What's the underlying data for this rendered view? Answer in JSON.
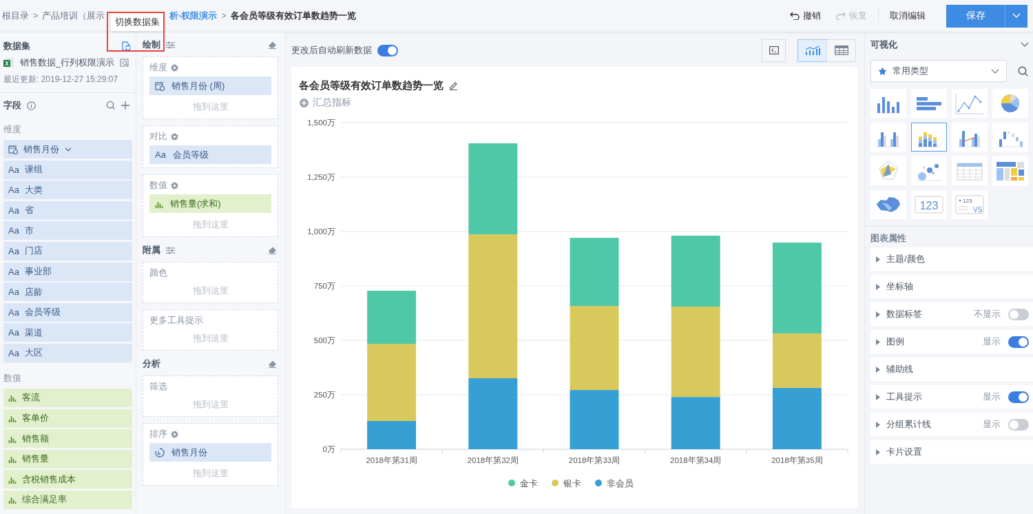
{
  "breadcrumb": [
    {
      "kind": "crumb",
      "label": "根目录"
    },
    {
      "kind": "separator",
      "label": ">"
    },
    {
      "kind": "crumb",
      "label": "产品培训（展示"
    },
    {
      "kind": "link",
      "label": "析-权限演示"
    },
    {
      "kind": "separator",
      "label": ">"
    },
    {
      "kind": "current",
      "label": "各会员等级有效订单数趋势一览"
    }
  ],
  "tooltip": {
    "text": "切换数据集"
  },
  "toolbar": {
    "undo": {
      "label": "撤销",
      "disabled": false
    },
    "redo": {
      "label": "恢复",
      "disabled": true
    },
    "cancel": "取消编辑",
    "save": "保存"
  },
  "dataset": {
    "title": "数据集",
    "name": "销售数据_行列权限演示",
    "updated": "最近更新: 2019-12-27 15:29:07"
  },
  "fields": {
    "title": "字段",
    "groups": [
      {
        "title": "维度",
        "kind": "dimension",
        "items": [
          {
            "label": "销售月份",
            "kind": "date",
            "expandable": true
          },
          {
            "label": "课组",
            "kind": "text",
            "type_label": "Aa"
          },
          {
            "label": "大类",
            "kind": "text",
            "type_label": "Aa"
          },
          {
            "label": "省",
            "kind": "text",
            "type_label": "Aa"
          },
          {
            "label": "市",
            "kind": "text",
            "type_label": "Aa"
          },
          {
            "label": "门店",
            "kind": "text",
            "type_label": "Aa"
          },
          {
            "label": "事业部",
            "kind": "text",
            "type_label": "Aa"
          },
          {
            "label": "店龄",
            "kind": "text",
            "type_label": "Aa"
          },
          {
            "label": "会员等级",
            "kind": "text",
            "type_label": "Aa"
          },
          {
            "label": "渠道",
            "kind": "text",
            "type_label": "Aa"
          },
          {
            "label": "大区",
            "kind": "text",
            "type_label": "Aa"
          }
        ]
      },
      {
        "title": "数值",
        "kind": "measure",
        "items": [
          {
            "label": "客流",
            "kind": "measure"
          },
          {
            "label": "客单价",
            "kind": "measure"
          },
          {
            "label": "销售额",
            "kind": "measure"
          },
          {
            "label": "销售量",
            "kind": "measure"
          },
          {
            "label": "含税销售成本",
            "kind": "measure"
          },
          {
            "label": "综合满足率",
            "kind": "measure"
          }
        ]
      }
    ]
  },
  "shelves": [
    {
      "title": "绘制",
      "adjustable": true,
      "wells": [
        {
          "label": "维度",
          "gear": true,
          "chips": [
            {
              "label": "销售月份 (周)",
              "kind": "date"
            }
          ],
          "hint": "拖到这里"
        },
        {
          "label": "对比",
          "gear": true,
          "chips": [
            {
              "label": "会员等级",
              "kind": "text",
              "type_label": "Aa"
            }
          ]
        },
        {
          "label": "数值",
          "gear": true,
          "chips": [
            {
              "label": "销售量(求和)",
              "kind": "measure"
            }
          ],
          "hint": "拖到这里"
        }
      ]
    },
    {
      "title": "附属",
      "adjustable": true,
      "wells": [
        {
          "label": "颜色",
          "gear": false,
          "hint": "拖到这里"
        },
        {
          "label": "更多工具提示",
          "gear": false,
          "hint": "拖到这里"
        }
      ]
    },
    {
      "title": "分析",
      "adjustable": false,
      "wells": [
        {
          "label": "筛选",
          "gear": false,
          "hint": "拖到这里"
        },
        {
          "label": "排序",
          "gear": true,
          "chips": [
            {
              "label": "销售月份",
              "kind": "sort"
            }
          ],
          "hint": "拖到这里"
        }
      ]
    }
  ],
  "canvas": {
    "auto_refresh": {
      "label": "更改后自动刷新数据",
      "on": true
    },
    "views": [
      {
        "kind": "code",
        "selected": false
      },
      {
        "kind": "chart",
        "selected": true
      },
      {
        "kind": "table",
        "selected": false
      }
    ],
    "title": "各会员等级有效订单数趋势一览",
    "summary": "汇总指标",
    "chart_data": {
      "type": "bar",
      "stacked": true,
      "categories": [
        "2018年第31周",
        "2018年第32周",
        "2018年第33周",
        "2018年第34周",
        "2018年第35周"
      ],
      "series": [
        {
          "name": "金卡",
          "color": "#4fc8a8",
          "values": [
            244,
            418,
            313,
            326,
            417
          ]
        },
        {
          "name": "银卡",
          "color": "#d9c95c",
          "values": [
            354,
            661,
            386,
            415,
            250
          ]
        },
        {
          "name": "非会员",
          "color": "#36a0d4",
          "values": [
            130,
            326,
            272,
            240,
            282
          ]
        }
      ],
      "ylim": [
        0,
        1500
      ],
      "grid": true,
      "legend": true,
      "yticks": [
        {
          "value": 0,
          "label": "0万"
        },
        {
          "value": 250,
          "label": "250万"
        },
        {
          "value": 500,
          "label": "500万"
        },
        {
          "value": 750,
          "label": "750万"
        },
        {
          "value": 1000,
          "label": "1,000万"
        },
        {
          "value": 1250,
          "label": "1,250万"
        },
        {
          "value": 1500,
          "label": "1,500万"
        }
      ]
    }
  },
  "visual": {
    "title": "可视化",
    "category": "常用类型",
    "types": [
      {
        "kind": "bar",
        "selected": false
      },
      {
        "kind": "hbar",
        "selected": false
      },
      {
        "kind": "line",
        "selected": false
      },
      {
        "kind": "pie",
        "selected": false
      },
      {
        "kind": "grouped",
        "selected": false
      },
      {
        "kind": "stacked",
        "selected": true
      },
      {
        "kind": "combo",
        "selected": false
      },
      {
        "kind": "waterfall",
        "selected": false
      },
      {
        "kind": "radar",
        "selected": false
      },
      {
        "kind": "bubble",
        "selected": false
      },
      {
        "kind": "table",
        "selected": false
      },
      {
        "kind": "treemap",
        "selected": false
      },
      {
        "kind": "map",
        "selected": false
      },
      {
        "kind": "kpi",
        "selected": false,
        "text": "123"
      },
      {
        "kind": "compare",
        "selected": false,
        "text": "123",
        "text_2": "VS"
      }
    ]
  },
  "properties": {
    "title": "图表属性",
    "items": [
      {
        "label": "主题/颜色"
      },
      {
        "label": "坐标轴"
      },
      {
        "label": "数据标签",
        "toggle": {
          "caption": "不显示",
          "on": false
        }
      },
      {
        "label": "图例",
        "toggle": {
          "caption": "显示",
          "on": true
        }
      },
      {
        "label": "辅助线"
      },
      {
        "label": "工具提示",
        "toggle": {
          "caption": "显示",
          "on": true
        }
      },
      {
        "label": "分组累计线",
        "toggle": {
          "caption": "显示",
          "on": false
        }
      },
      {
        "label": "卡片设置"
      }
    ]
  }
}
